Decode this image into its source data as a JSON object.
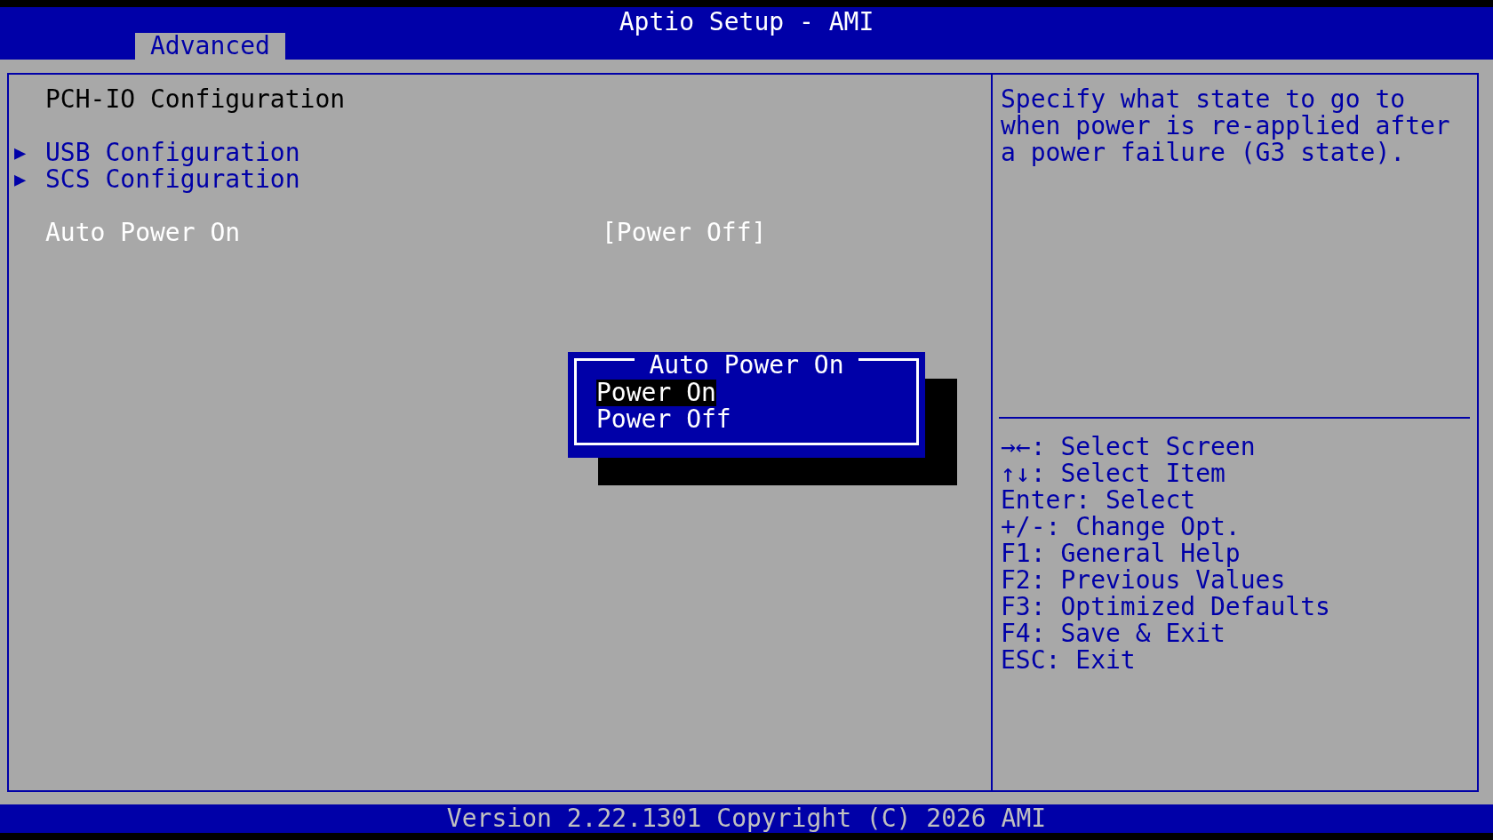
{
  "header": {
    "title": "Aptio Setup - AMI"
  },
  "tabs": [
    {
      "label": "Advanced",
      "selected": true
    }
  ],
  "page": {
    "title": "PCH-IO Configuration",
    "items": [
      {
        "kind": "submenu",
        "marker": "▶",
        "label": "USB Configuration"
      },
      {
        "kind": "submenu",
        "marker": "▶",
        "label": "SCS Configuration"
      },
      {
        "kind": "setting",
        "label": "Auto Power On",
        "value": "[Power Off]"
      }
    ]
  },
  "help": {
    "text": "Specify what state to go to when power is re-applied after a power failure (G3 state).",
    "keys": [
      "→←: Select Screen",
      "↑↓: Select Item",
      "Enter: Select",
      "+/-: Change Opt.",
      "F1: General Help",
      "F2: Previous Values",
      "F3: Optimized Defaults",
      "F4: Save & Exit",
      "ESC: Exit"
    ]
  },
  "popup": {
    "title": "Auto Power On",
    "options": [
      {
        "label": "Power On",
        "selected": true
      },
      {
        "label": "Power Off",
        "selected": false
      }
    ]
  },
  "footer": "Version 2.22.1301 Copyright (C) 2026 AMI"
}
